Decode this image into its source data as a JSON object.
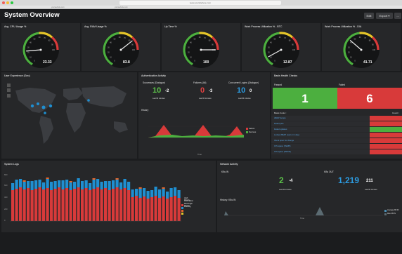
{
  "browser": {
    "url": "www.yoursitehere.com",
    "tabs": [
      "yourwebsite.com",
      "yourwebsite.com"
    ]
  },
  "header": {
    "title": "System Overview",
    "edit_label": "Edit",
    "export_label": "Export ▾",
    "more_label": "..."
  },
  "gauges": [
    {
      "title": "Avg. CPU Usage %",
      "value": "23.33",
      "level": 0.23
    },
    {
      "title": "Avg. RAM Usage %",
      "value": "83.8",
      "level": 0.84
    },
    {
      "title": "Up Time %",
      "value": "100",
      "level": 1.0
    },
    {
      "title": "Work Process Utilization % - BTC",
      "value": "12.87",
      "level": 0.13
    },
    {
      "title": "Work Process Utilization % - DIA",
      "value": "41.71",
      "level": 0.42
    }
  ],
  "gauge_ticks": [
    "0",
    "10",
    "20",
    "30",
    "40",
    "50",
    "60",
    "70",
    "80",
    "90",
    "100"
  ],
  "user_experience": {
    "title": "User Experience (Geo)"
  },
  "auth": {
    "title": "Authentication Activity",
    "successes": {
      "label": "Successes (Dialogue)",
      "value": "10",
      "delta": "-2",
      "sub": "Last 60 minutes"
    },
    "failures": {
      "label": "Failures (All)",
      "value": "0",
      "delta": "-3",
      "sub": "Last 60 minutes"
    },
    "concurrent": {
      "label": "Concurrent Logins (Dialogue)",
      "value": "10",
      "delta": "0",
      "sub": "Last 60 minutes"
    },
    "history_title": "History",
    "legend": [
      "Failure",
      "Success"
    ],
    "xlabel": "Time"
  },
  "health": {
    "title": "Basis Health Checks",
    "passed_label": "Passed",
    "failed_label": "Failed",
    "passed_value": "1",
    "failed_value": "6",
    "table_header": "Basis Code ↕",
    "count_header": "Count ↕",
    "rows": [
      "ABAP dumps",
      "Failed jobs",
      "Failed updates",
      "Locked ABAP users (>1 day)",
      "Client open for change",
      "O/S space (TEMP)",
      "O/S space (PROD)"
    ]
  },
  "logs": {
    "title": "System Logs",
    "legend": [
      "High Priority",
      "Information",
      "Med./High Priority",
      "Warning"
    ],
    "yticks": [
      "800",
      "600",
      "400",
      "200",
      "0"
    ]
  },
  "network": {
    "title": "Network Activity",
    "kbin_label": "KBs IN",
    "kbout_label": "KBs OUT",
    "kbin_value": "2",
    "kbin_delta": "-4",
    "kbout_value": "1,219",
    "kbout_delta": "211",
    "sub": "Last 60 minutes",
    "history_title": "History: KBs IN",
    "legend": [
      "Average KB IN",
      "Max KB IN"
    ],
    "xlabel": "Time"
  },
  "colors": {
    "green": "#4caf3f",
    "red": "#d83a3a",
    "blue": "#1f8fd1",
    "orange": "#e4672b",
    "yellow": "#e6c62a"
  }
}
